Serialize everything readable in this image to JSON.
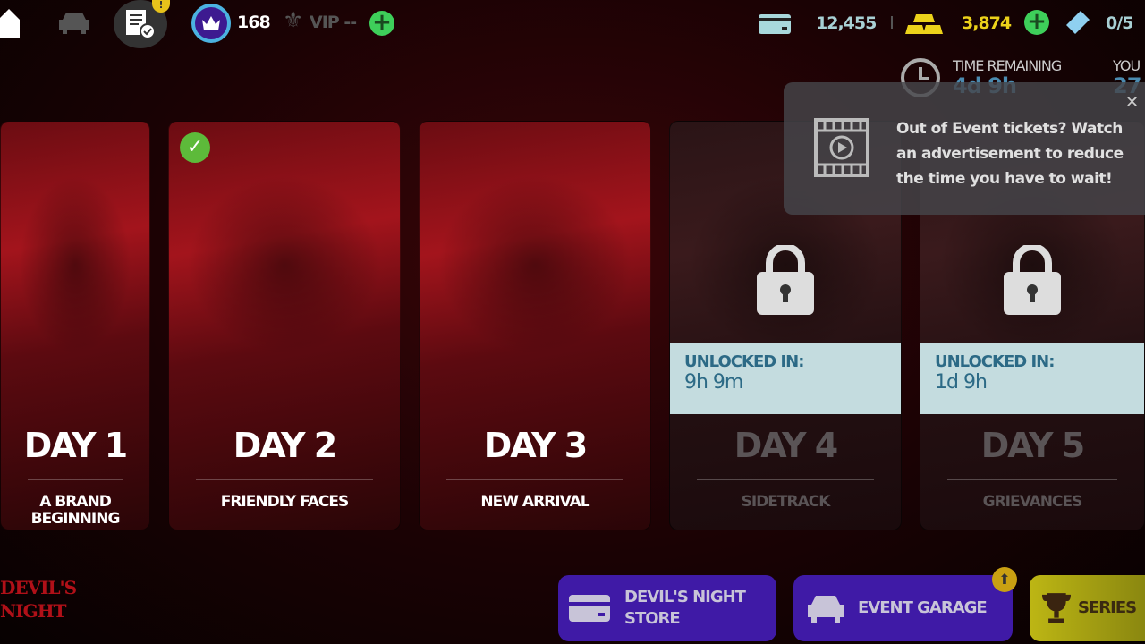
{
  "topbar": {
    "level": "168",
    "vip": "VIP --",
    "cash": "12,455",
    "gold": "3,874",
    "tickets": "0/5",
    "tasks_alert": "!"
  },
  "event": {
    "time_label": "TIME REMAINING",
    "time_value": "4d 9h",
    "you_label": "YOU",
    "you_value": "27"
  },
  "tooltip": {
    "text": "Out of Event tickets? Watch an advertisement to reduce the time you have to wait!"
  },
  "days": [
    {
      "day": "DAY 1",
      "title": "A BRAND BEGINNING",
      "state": "open"
    },
    {
      "day": "DAY 2",
      "title": "FRIENDLY FACES",
      "state": "completed"
    },
    {
      "day": "DAY 3",
      "title": "NEW ARRIVAL",
      "state": "open"
    },
    {
      "day": "DAY 4",
      "title": "SIDETRACK",
      "state": "locked",
      "unlock_label": "UNLOCKED IN:",
      "unlock_time": "9h 9m"
    },
    {
      "day": "DAY 5",
      "title": "GRIEVANCES",
      "state": "locked",
      "unlock_label": "UNLOCKED IN:",
      "unlock_time": "1d 9h"
    }
  ],
  "bottom": {
    "logo": "DEVIL'S NIGHT",
    "store_line1": "DEVIL'S NIGHT",
    "store_line2": "STORE",
    "garage": "EVENT GARAGE",
    "series": "SERIES"
  },
  "colors": {
    "purple": "#3f1aa6",
    "yellow": "#c9c416",
    "banner": "#c4dcdf",
    "accent_blue": "#4a8bb0",
    "green": "#3ecf5a"
  }
}
